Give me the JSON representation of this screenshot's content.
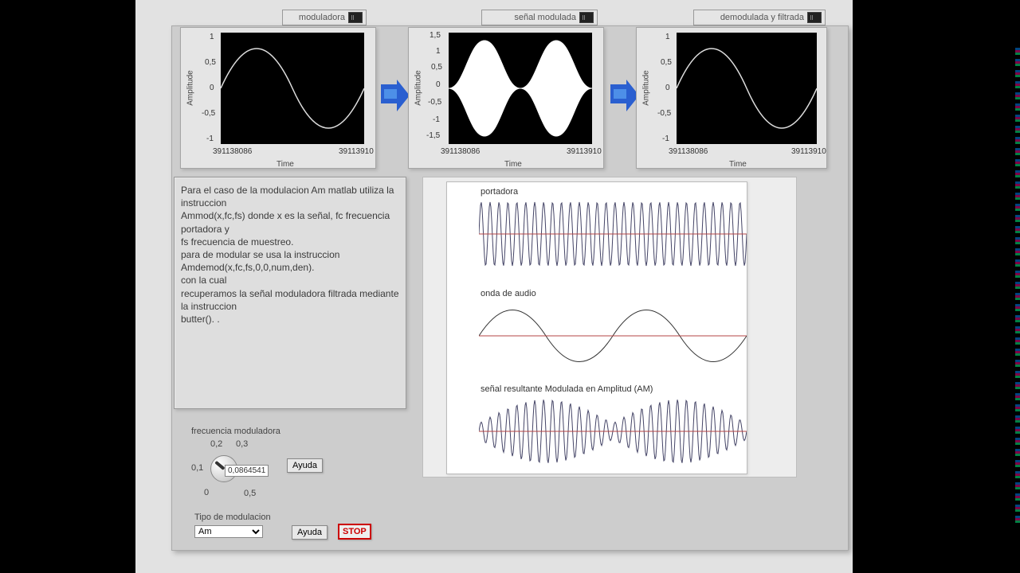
{
  "scopes": {
    "s1": {
      "title": "moduladora",
      "ylabel": "Amplitude",
      "xlabel": "Time",
      "yticks": [
        "1",
        "0,5",
        "0",
        "-0,5",
        "-1"
      ],
      "xticks": [
        "391138086",
        "39113910"
      ]
    },
    "s2": {
      "title": "señal modulada",
      "ylabel": "Amplitude",
      "xlabel": "Time",
      "yticks": [
        "1,5",
        "1",
        "0,5",
        "0",
        "-0,5",
        "-1",
        "-1,5"
      ],
      "xticks": [
        "391138086",
        "39113910"
      ]
    },
    "s3": {
      "title": "demodulada y filtrada",
      "ylabel": "Amplitude",
      "xlabel": "Time",
      "yticks": [
        "1",
        "0,5",
        "0",
        "-0,5",
        "-1"
      ],
      "xticks": [
        "391138086",
        "39113910"
      ]
    }
  },
  "info_text": "Para el caso de la modulacion Am matlab utiliza la instruccion\nAmmod(x,fc,fs) donde x es la señal, fc frecuencia portadora y\nfs frecuencia de muestreo.\npara de modular se usa la instruccion Amdemod(x,fc,fs,0,0,num,den).\ncon la cual\nrecuperamos la señal moduladora filtrada mediante la instruccion\nbutter(). .",
  "diagram": {
    "t1": "portadora",
    "t2": "onda de audio",
    "t3": "señal resultante Modulada en Amplitud (AM)"
  },
  "controls": {
    "knob_label": "frecuencia moduladora",
    "knob_ticks": {
      "t0": "0",
      "t01": "0,1",
      "t02": "0,2",
      "t03": "0,3",
      "t05": "0,5"
    },
    "knob_value": "0,0864541",
    "ayuda": "Ayuda",
    "tipo_label": "Tipo de modulacion",
    "tipo_value": "Am",
    "stop": "STOP"
  },
  "chart_data": [
    {
      "type": "line",
      "title": "moduladora",
      "xlabel": "Time",
      "ylabel": "Amplitude",
      "ylim": [
        -1,
        1
      ],
      "x_range": [
        391138086,
        391139100
      ],
      "series": [
        {
          "name": "sine",
          "freq_hz_approx": 0.086,
          "amplitude": 1.0,
          "offset": 0,
          "cycles_visible": 1
        }
      ]
    },
    {
      "type": "line",
      "title": "señal modulada",
      "xlabel": "Time",
      "ylabel": "Amplitude",
      "ylim": [
        -1.5,
        1.5
      ],
      "x_range": [
        391138086,
        391139100
      ],
      "series": [
        {
          "name": "AM envelope",
          "envelope_max": 1.5,
          "envelope_min": 0,
          "lobes_visible": 2
        }
      ]
    },
    {
      "type": "line",
      "title": "demodulada y filtrada",
      "xlabel": "Time",
      "ylabel": "Amplitude",
      "ylim": [
        -1,
        1
      ],
      "x_range": [
        391138086,
        391139100
      ],
      "series": [
        {
          "name": "recovered sine",
          "freq_hz_approx": 0.086,
          "amplitude": 1.0,
          "offset": 0,
          "cycles_visible": 1
        }
      ]
    },
    {
      "type": "line",
      "title": "portadora",
      "series": [
        {
          "name": "carrier",
          "cycles_visible": 30,
          "amplitude": 1
        }
      ]
    },
    {
      "type": "line",
      "title": "onda de audio",
      "series": [
        {
          "name": "audio",
          "cycles_visible": 2,
          "amplitude": 1
        }
      ]
    },
    {
      "type": "line",
      "title": "señal resultante Modulada en Amplitud (AM)",
      "series": [
        {
          "name": "AM",
          "envelope_cycles": 2,
          "carrier_cycles": 30
        }
      ]
    }
  ]
}
